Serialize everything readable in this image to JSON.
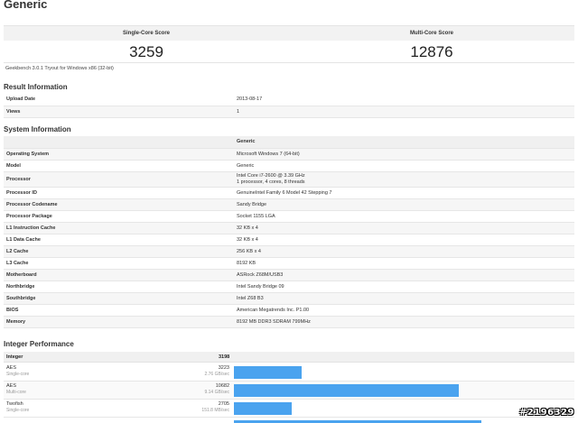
{
  "title": "Generic",
  "scores": {
    "single_label": "Single-Core Score",
    "single_value": "3259",
    "multi_label": "Multi-Core Score",
    "multi_value": "12876"
  },
  "version": "Geekbench 3.0.1 Tryout for Windows x86 (32-bit)",
  "result_info": {
    "heading": "Result Information",
    "rows": [
      {
        "k": "Upload Date",
        "v": "2013-08-17"
      },
      {
        "k": "Views",
        "v": "1"
      }
    ]
  },
  "system_info": {
    "heading": "System Information",
    "column_header": "Generic",
    "rows": [
      {
        "k": "Operating System",
        "v": "Microsoft Windows 7 (64-bit)"
      },
      {
        "k": "Model",
        "v": "Generic"
      },
      {
        "k": "Processor",
        "v": "Intel Core i7-2600 @ 3.39 GHz",
        "v2": "1 processor, 4 cores, 8 threads"
      },
      {
        "k": "Processor ID",
        "v": "GenuineIntel Family 6 Model 42 Stepping 7"
      },
      {
        "k": "Processor Codename",
        "v": "Sandy Bridge"
      },
      {
        "k": "Processor Package",
        "v": "Socket 1155 LGA"
      },
      {
        "k": "L1 Instruction Cache",
        "v": "32 KB x 4"
      },
      {
        "k": "L1 Data Cache",
        "v": "32 KB x 4"
      },
      {
        "k": "L2 Cache",
        "v": "256 KB x 4"
      },
      {
        "k": "L3 Cache",
        "v": "8192 KB"
      },
      {
        "k": "Motherboard",
        "v": "ASRock Z68M/USB3"
      },
      {
        "k": "Northbridge",
        "v": "Intel Sandy Bridge 09"
      },
      {
        "k": "Southbridge",
        "v": "Intel Z68 B3"
      },
      {
        "k": "BIOS",
        "v": "American Megatrends Inc. P1.00"
      },
      {
        "k": "Memory",
        "v": "8192 MB DDR3 SDRAM 799MHz"
      }
    ]
  },
  "integer_perf": {
    "heading": "Integer Performance",
    "header_label": "Integer",
    "header_score": "3198",
    "rows": [
      {
        "name": "AES",
        "mode": "Single-core",
        "score": "3223",
        "rate": "2.76 GB/sec",
        "bar_fraction": 0.2
      },
      {
        "name": "AES",
        "mode": "Multi-core",
        "score": "10682",
        "rate": "9.14 GB/sec",
        "bar_fraction": 0.66
      },
      {
        "name": "Twofish",
        "mode": "Single-core",
        "score": "2705",
        "rate": "151.8 MB/sec",
        "bar_fraction": 0.17
      }
    ]
  },
  "watermark": "#2196329",
  "colors": {
    "bar": "#4aa3ef",
    "header_bg": "#f0f0f0"
  }
}
